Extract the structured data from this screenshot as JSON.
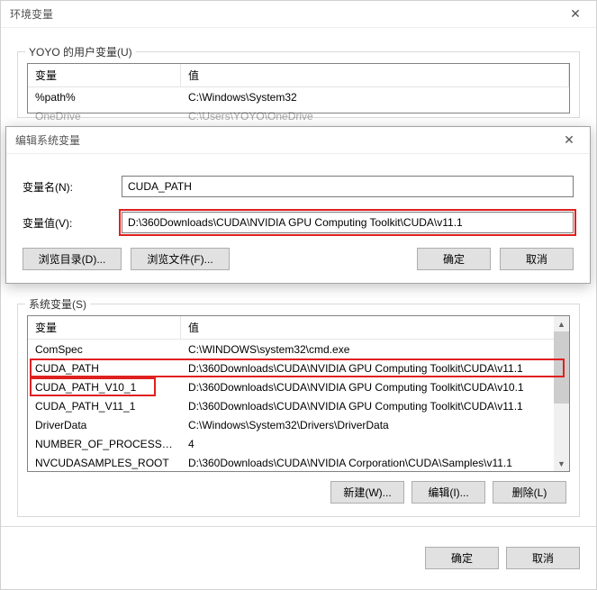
{
  "mainDialog": {
    "title": "环境变量"
  },
  "userVars": {
    "legend": "YOYO 的用户变量(U)",
    "headers": {
      "name": "变量",
      "value": "值"
    },
    "rows": [
      {
        "name": "%path%",
        "value": "C:\\Windows\\System32"
      },
      {
        "name": "OneDrive",
        "value": "C:\\Users\\YOYO\\OneDrive"
      }
    ]
  },
  "editDialog": {
    "title": "编辑系统变量",
    "nameLabel": "变量名(N):",
    "valueLabel": "变量值(V):",
    "nameValue": "CUDA_PATH",
    "valueValue": "D:\\360Downloads\\CUDA\\NVIDIA GPU Computing Toolkit\\CUDA\\v11.1",
    "browseDir": "浏览目录(D)...",
    "browseFile": "浏览文件(F)...",
    "ok": "确定",
    "cancel": "取消"
  },
  "sysVars": {
    "legend": "系统变量(S)",
    "headers": {
      "name": "变量",
      "value": "值"
    },
    "rows": [
      {
        "name": "ComSpec",
        "value": "C:\\WINDOWS\\system32\\cmd.exe"
      },
      {
        "name": "CUDA_PATH",
        "value": "D:\\360Downloads\\CUDA\\NVIDIA GPU Computing Toolkit\\CUDA\\v11.1"
      },
      {
        "name": "CUDA_PATH_V10_1",
        "value": "D:\\360Downloads\\CUDA\\NVIDIA GPU Computing Toolkit\\CUDA\\v10.1"
      },
      {
        "name": "CUDA_PATH_V11_1",
        "value": "D:\\360Downloads\\CUDA\\NVIDIA GPU Computing Toolkit\\CUDA\\v11.1"
      },
      {
        "name": "DriverData",
        "value": "C:\\Windows\\System32\\Drivers\\DriverData"
      },
      {
        "name": "NUMBER_OF_PROCESSORS",
        "value": "4"
      },
      {
        "name": "NVCUDASAMPLES_ROOT",
        "value": "D:\\360Downloads\\CUDA\\NVIDIA Corporation\\CUDA\\Samples\\v11.1"
      }
    ],
    "buttons": {
      "new": "新建(W)...",
      "edit": "编辑(I)...",
      "delete": "删除(L)"
    }
  },
  "bottom": {
    "ok": "确定",
    "cancel": "取消"
  }
}
